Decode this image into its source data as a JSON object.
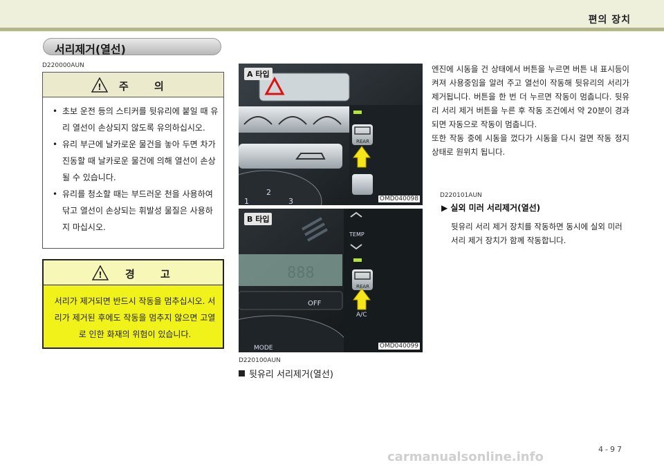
{
  "header": {
    "title": "편의 장치"
  },
  "section": {
    "title": "서리제거(열선)"
  },
  "caution": {
    "code": "D220000AUN",
    "heading": "주 의",
    "items": [
      "초보 운전 등의 스티커를 뒷유리에 붙일 때 유리 열선이 손상되지 않도록 유의하십시오.",
      "유리 부근에 날카로운 물건을 놓아 두면 차가 진동할 때 날카로운 물건에 의해 열선이 손상될 수 있습니다.",
      "유리를 청소할 때는 부드러운 천을 사용하여 닦고 열선이 손상되는 휘발성 물질은 사용하지 마십시오."
    ]
  },
  "warning": {
    "heading": "경 고",
    "text": "서리가 제거되면 반드시 작동을 멈추십시오. 서리가 제거된 후에도 작동을 멈추지 않으면 고열로 인한 화재의 위험이 있습니다."
  },
  "figures": {
    "a": {
      "type_label": "A 타입",
      "code": "OMD040098",
      "labels": {
        "rear": "REAR",
        "n1": "1",
        "n2": "2",
        "n3": "3"
      }
    },
    "b": {
      "type_label": "B 타입",
      "code": "OMD040099",
      "labels": {
        "temp": "TEMP",
        "rear": "REAR",
        "off": "OFF",
        "ac": "A/C",
        "mode": "MODE"
      }
    },
    "caption_code": "D220100AUN",
    "caption": "뒷유리 서리제거(열선)"
  },
  "body": {
    "p1": "엔진에 시동을 건 상태에서 버튼을 누르면 버튼 내 표시등이 켜져 사용중임을 알려 주고 열선이 작동해 뒷유리의 서리가 제거됩니다. 버튼을 한 번 더 누르면 작동이 멈춥니다. 뒷유리 서리 제거 버튼을 누른 후 작동 조건에서 약 20분이 경과되면 자동으로 작동이 멈춥니다.",
    "p2": "또한 작동 중에 시동을 껐다가 시동을 다시 걸면 작동 정지 상태로 원위치 됩니다."
  },
  "sub": {
    "code": "D220101AUN",
    "heading": "▶ 실외 미러 서리제거(열선)",
    "text": "뒷유리 서리 제거 장치를 작동하면 동시에 실외 미러 서리 제거 장치가 함께 작동합니다."
  },
  "footer": {
    "page": "4-97",
    "watermark": "carmanualsonline.info"
  }
}
